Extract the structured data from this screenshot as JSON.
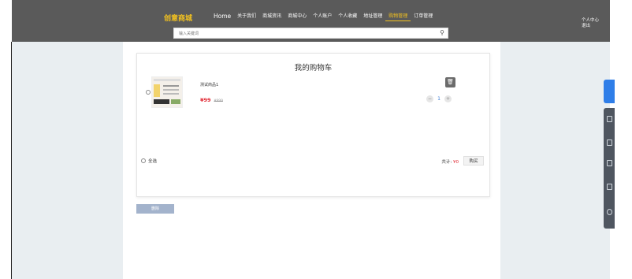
{
  "header": {
    "logo": "创意商城",
    "nav": [
      "Home",
      "关于我们",
      "商城资讯",
      "商城中心",
      "个人账户",
      "个人收藏",
      "地址管理",
      "购物管理",
      "订单管理"
    ],
    "active_nav": "购物管理",
    "user_links": [
      "个人中心",
      "退出"
    ]
  },
  "search": {
    "placeholder": "输入关键词"
  },
  "cart": {
    "title": "我的购物车",
    "items": [
      {
        "name": "测试商品1",
        "price": "¥99",
        "old_price": "¥999",
        "quantity": "1"
      }
    ],
    "select_all_label": "全选",
    "total_label": "共计: ",
    "total_amount": "¥0",
    "buy_label": "购买",
    "delete_label": "删除"
  },
  "colors": {
    "accent": "#f3c21f",
    "price": "#e0242f",
    "header_bg": "#5a5a5a",
    "side_tab": "#2f7ee8"
  }
}
